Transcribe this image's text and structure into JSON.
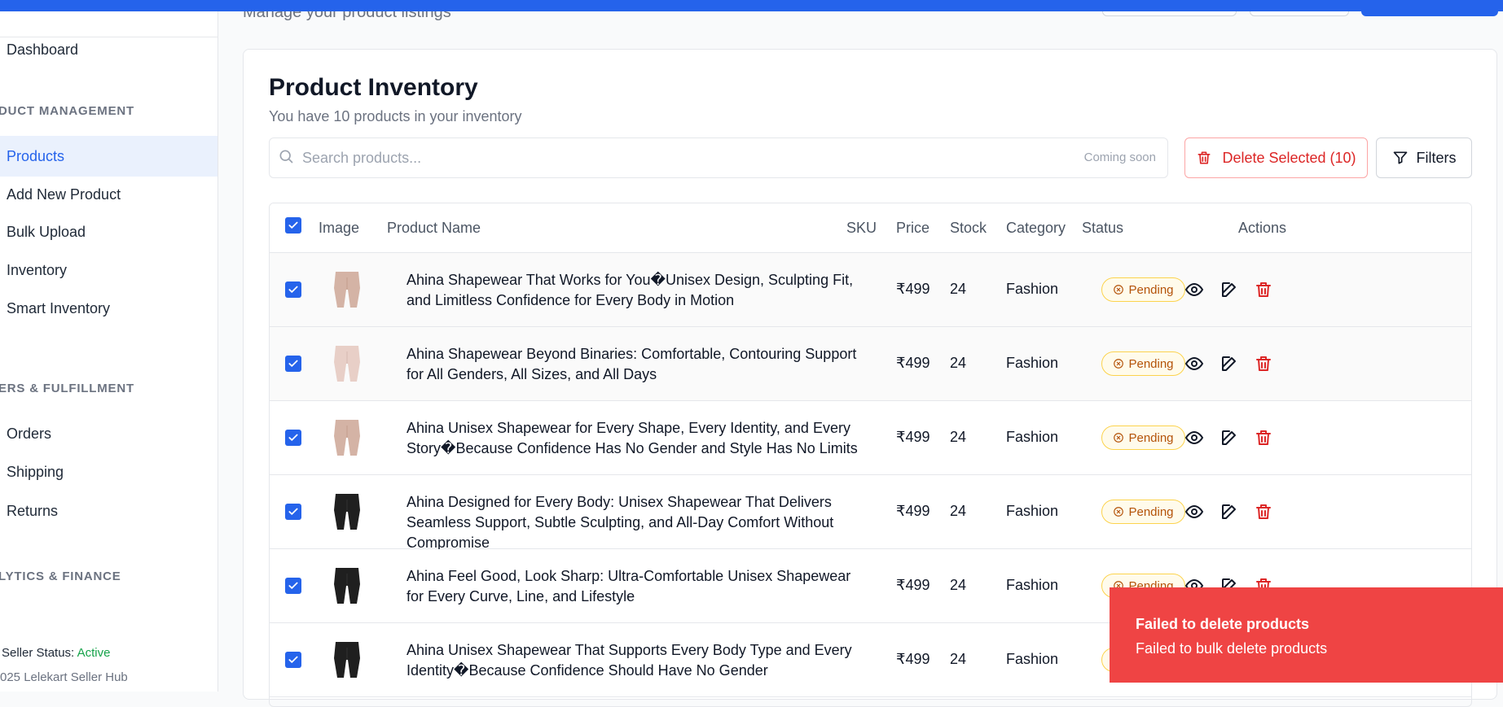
{
  "header": {
    "subtitle": "Manage your product listings"
  },
  "sidebar": {
    "items": [
      {
        "label": "Dashboard"
      },
      {
        "label": "Products",
        "active": true
      },
      {
        "label": "Add New Product"
      },
      {
        "label": "Bulk Upload"
      },
      {
        "label": "Inventory"
      },
      {
        "label": "Smart Inventory"
      },
      {
        "label": "Orders"
      },
      {
        "label": "Shipping"
      },
      {
        "label": "Returns"
      }
    ],
    "sections": [
      "DUCT MANAGEMENT",
      "ERS & FULFILLMENT",
      "LYTICS & FINANCE"
    ],
    "status_label": "Seller Status:",
    "status_value": "Active",
    "copyright": "025 Lelekart Seller Hub"
  },
  "main": {
    "title": "Product Inventory",
    "subtitle": "You have 10 products in your inventory",
    "search": {
      "placeholder": "Search products...",
      "value": "",
      "note": "Coming soon"
    },
    "delete_selected_label": "Delete Selected (10)",
    "filters_label": "Filters",
    "table": {
      "headers": {
        "image": "Image",
        "name": "Product Name",
        "sku": "SKU",
        "price": "Price",
        "stock": "Stock",
        "category": "Category",
        "status": "Status",
        "actions": "Actions"
      },
      "rows": [
        {
          "name": "Ahina Shapewear That Works for You�Unisex Design, Sculpting Fit, and Limitless Confidence for Every Body in Motion",
          "sku": "",
          "price": "₹499",
          "stock": "24",
          "category": "Fashion",
          "status": "Pending",
          "thumb": "beige"
        },
        {
          "name": "Ahina Shapewear Beyond Binaries: Comfortable, Contouring Support for All Genders, All Sizes, and All Days",
          "sku": "",
          "price": "₹499",
          "stock": "24",
          "category": "Fashion",
          "status": "Pending",
          "thumb": "pink"
        },
        {
          "name": "Ahina Unisex Shapewear for Every Shape, Every Identity, and Every Story�Because Confidence Has No Gender and Style Has No Limits",
          "sku": "",
          "price": "₹499",
          "stock": "24",
          "category": "Fashion",
          "status": "Pending",
          "thumb": "beige"
        },
        {
          "name": "Ahina Designed for Every Body: Unisex Shapewear That Delivers Seamless Support, Subtle Sculpting, and All-Day Comfort Without Compromise",
          "sku": "",
          "price": "₹499",
          "stock": "24",
          "category": "Fashion",
          "status": "Pending",
          "thumb": "black"
        },
        {
          "name": "Ahina Feel Good, Look Sharp: Ultra-Comfortable Unisex Shapewear for Every Curve, Line, and Lifestyle",
          "sku": "",
          "price": "₹499",
          "stock": "24",
          "category": "Fashion",
          "status": "Pending",
          "thumb": "black"
        },
        {
          "name": "Ahina Unisex Shapewear That Supports Every Body Type and Every Identity�Because Confidence Should Have No Gender",
          "sku": "",
          "price": "₹499",
          "stock": "24",
          "category": "Fashion",
          "status": "Pending",
          "thumb": "black"
        }
      ]
    }
  },
  "toast": {
    "title": "Failed to delete products",
    "message": "Failed to bulk delete products"
  },
  "colors": {
    "accent": "#2563eb",
    "danger": "#ef4444",
    "pending": "#b45309",
    "active": "#16a34a"
  }
}
